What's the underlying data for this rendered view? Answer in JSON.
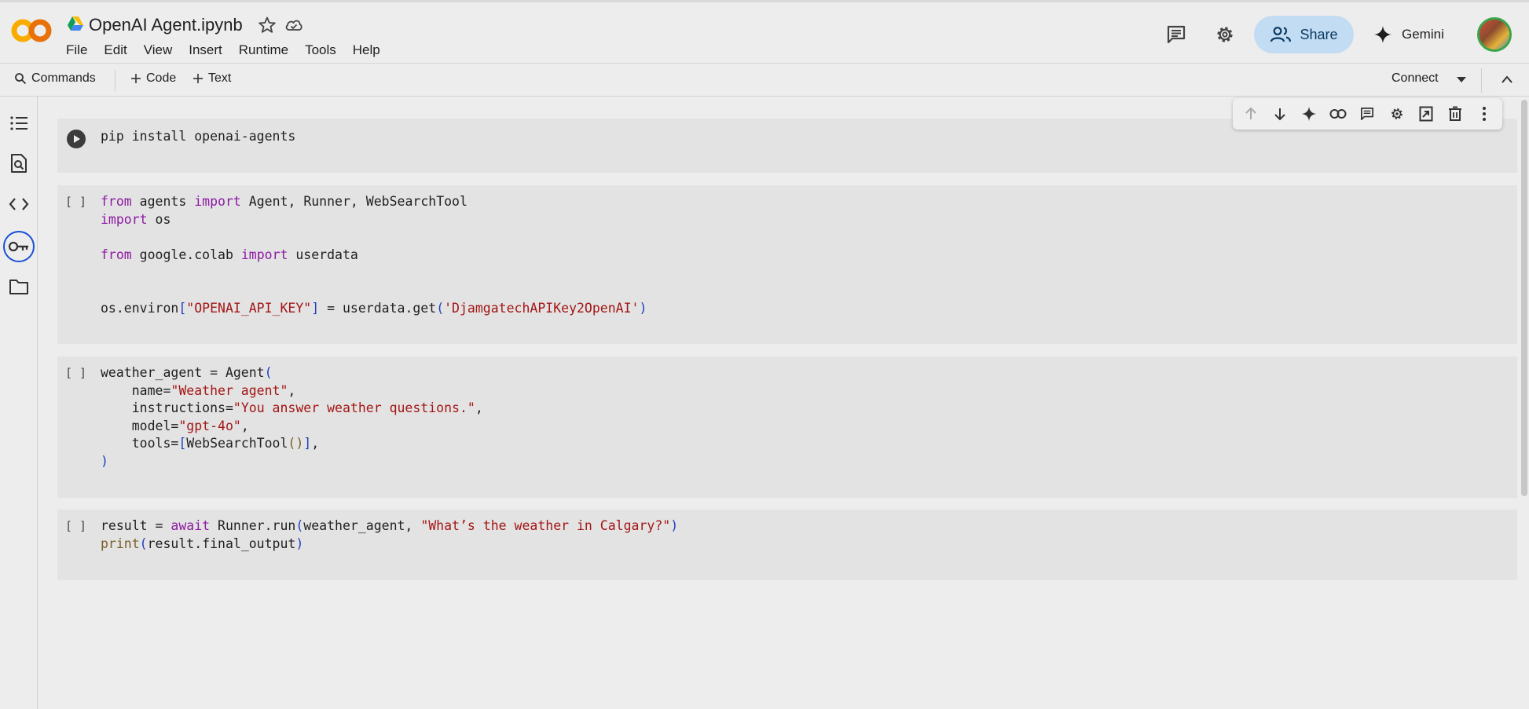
{
  "app": {
    "notebook_title": "OpenAI Agent.ipynb"
  },
  "menu": {
    "items": [
      "File",
      "Edit",
      "View",
      "Insert",
      "Runtime",
      "Tools",
      "Help"
    ]
  },
  "header_actions": {
    "share_label": "Share",
    "gemini_label": "Gemini"
  },
  "toolbar": {
    "commands_label": "Commands",
    "code_label": "Code",
    "text_label": "Text",
    "connect_label": "Connect"
  },
  "cells": [
    {
      "exec_marker": "",
      "lines": [
        "pip install openai-agents"
      ]
    },
    {
      "exec_marker": "[ ]",
      "lines": [
        "from agents import Agent, Runner, WebSearchTool",
        "import os",
        "",
        "from google.colab import userdata",
        "",
        "",
        "os.environ[\"OPENAI_API_KEY\"] = userdata.get('DjamgatechAPIKey2OpenAI')"
      ]
    },
    {
      "exec_marker": "[ ]",
      "lines": [
        "weather_agent = Agent(",
        "    name=\"Weather agent\",",
        "    instructions=\"You answer weather questions.\",",
        "    model=\"gpt-4o\",",
        "    tools=[WebSearchTool()],",
        ")"
      ]
    },
    {
      "exec_marker": "[ ]",
      "lines": [
        "result = await Runner.run(weather_agent, \"What’s the weather in Calgary?\")",
        "print(result.final_output)"
      ]
    }
  ],
  "colors": {
    "keyword": "#8c1aa3",
    "string": "#a31515",
    "bracket": "#1f3fbf",
    "share_bg": "#c2dcf3",
    "cell_bg": "#e3e3e3"
  }
}
